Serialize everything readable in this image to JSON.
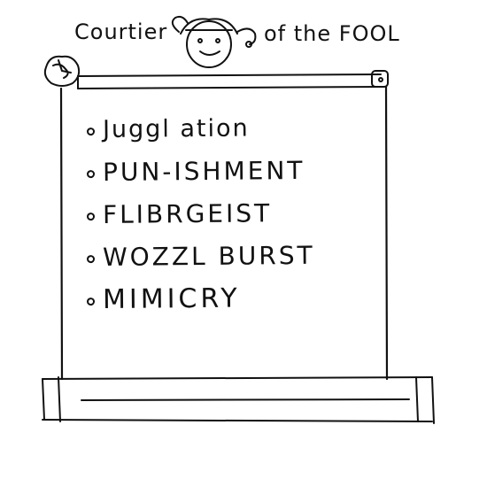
{
  "title": {
    "left": "Courtier",
    "right": "of the FOOL"
  },
  "moves": [
    {
      "label": "Juggl ation"
    },
    {
      "label": "PUN-ISHMENT"
    },
    {
      "label": "FLIBRGEIST"
    },
    {
      "label": "WOZZL BURST"
    },
    {
      "label": "MIMICRY"
    }
  ],
  "icons": {
    "portrait": "jester-face-icon",
    "scroll_knob": "crumpled-paper-icon",
    "scroll_cap": "scroll-knob-icon"
  },
  "colors": {
    "ink": "#111111",
    "paper": "#ffffff"
  }
}
